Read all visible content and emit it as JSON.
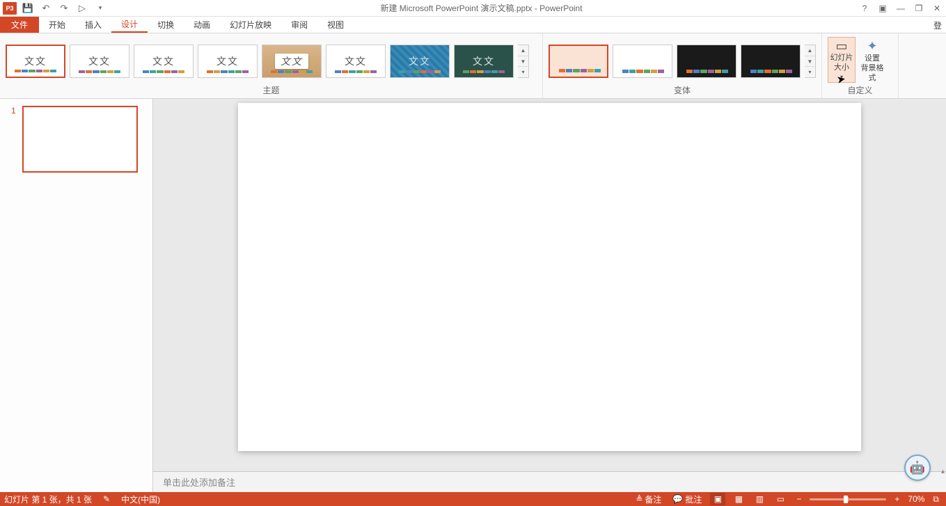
{
  "app": {
    "title": "新建 Microsoft PowerPoint 演示文稿.pptx - PowerPoint",
    "icon_label": "P3"
  },
  "qat": {
    "save": "💾",
    "undo": "↶",
    "redo": "↷",
    "start": "▷",
    "more": "▾"
  },
  "win": {
    "help": "?",
    "ribbon_opts": "▣",
    "min": "—",
    "restore": "❐",
    "close": "✕"
  },
  "tabs": {
    "file": "文件",
    "home": "开始",
    "insert": "插入",
    "design": "设计",
    "transitions": "切换",
    "animations": "动画",
    "slideshow": "幻灯片放映",
    "review": "审阅",
    "view": "视图"
  },
  "signin": "登",
  "ribbon": {
    "themes_label": "主题",
    "variants_label": "变体",
    "customize_label": "自定义",
    "theme_sample": "文文",
    "slide_size": "幻灯片\n大小",
    "format_bg": "设置\n背景格式",
    "dropdown_marker": "▾"
  },
  "slides": {
    "current_index": "1"
  },
  "notes": {
    "placeholder": "单击此处添加备注"
  },
  "status": {
    "slide_info": "幻灯片 第 1 张，共 1 张",
    "spellcheck": "✎",
    "language": "中文(中国)",
    "notes_btn": "备注",
    "comments_btn": "批注",
    "zoom_out": "−",
    "zoom_in": "+",
    "zoom_pct": "70%",
    "fit": "⧉",
    "notes_icon": "≜",
    "comments_icon": "💬"
  },
  "assistant": {
    "face": "🤖"
  }
}
